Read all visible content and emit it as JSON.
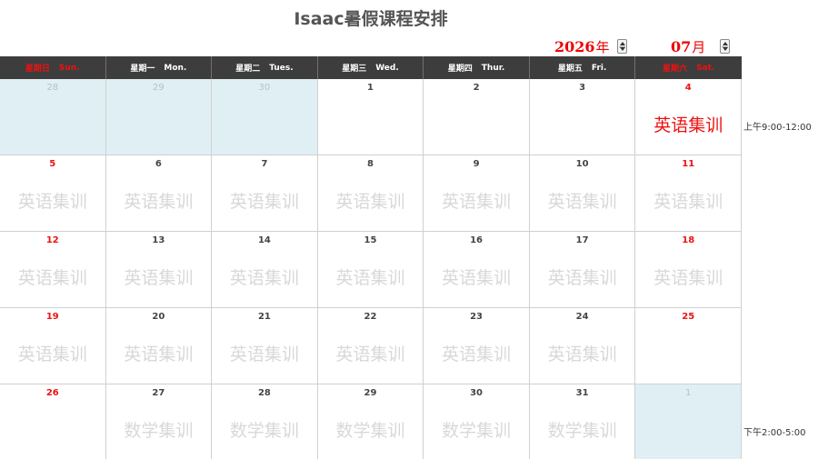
{
  "title": "Isaac暑假课程安排",
  "selector": {
    "year": "2026",
    "year_unit": "年",
    "month": "07",
    "month_unit": "月"
  },
  "weekdays": [
    {
      "cn": "星期日",
      "en": "Sun.",
      "weekend": true
    },
    {
      "cn": "星期一",
      "en": "Mon.",
      "weekend": false
    },
    {
      "cn": "星期二",
      "en": "Tues.",
      "weekend": false
    },
    {
      "cn": "星期三",
      "en": "Wed.",
      "weekend": false
    },
    {
      "cn": "星期四",
      "en": "Thur.",
      "weekend": false
    },
    {
      "cn": "星期五",
      "en": "Fri.",
      "weekend": false
    },
    {
      "cn": "星期六",
      "en": "Sat.",
      "weekend": true
    }
  ],
  "weeks": [
    [
      {
        "day": "28",
        "other": true,
        "event": ""
      },
      {
        "day": "29",
        "other": true,
        "event": ""
      },
      {
        "day": "30",
        "other": true,
        "event": ""
      },
      {
        "day": "1",
        "other": false,
        "event": ""
      },
      {
        "day": "2",
        "other": false,
        "event": ""
      },
      {
        "day": "3",
        "other": false,
        "event": ""
      },
      {
        "day": "4",
        "other": false,
        "event": "英语集训",
        "highlight": true
      }
    ],
    [
      {
        "day": "5",
        "other": false,
        "event": "英语集训"
      },
      {
        "day": "6",
        "other": false,
        "event": "英语集训"
      },
      {
        "day": "7",
        "other": false,
        "event": "英语集训"
      },
      {
        "day": "8",
        "other": false,
        "event": "英语集训"
      },
      {
        "day": "9",
        "other": false,
        "event": "英语集训"
      },
      {
        "day": "10",
        "other": false,
        "event": "英语集训"
      },
      {
        "day": "11",
        "other": false,
        "event": "英语集训"
      }
    ],
    [
      {
        "day": "12",
        "other": false,
        "event": "英语集训"
      },
      {
        "day": "13",
        "other": false,
        "event": "英语集训"
      },
      {
        "day": "14",
        "other": false,
        "event": "英语集训"
      },
      {
        "day": "15",
        "other": false,
        "event": "英语集训"
      },
      {
        "day": "16",
        "other": false,
        "event": "英语集训"
      },
      {
        "day": "17",
        "other": false,
        "event": "英语集训"
      },
      {
        "day": "18",
        "other": false,
        "event": "英语集训"
      }
    ],
    [
      {
        "day": "19",
        "other": false,
        "event": "英语集训"
      },
      {
        "day": "20",
        "other": false,
        "event": "英语集训"
      },
      {
        "day": "21",
        "other": false,
        "event": "英语集训"
      },
      {
        "day": "22",
        "other": false,
        "event": "英语集训"
      },
      {
        "day": "23",
        "other": false,
        "event": "英语集训"
      },
      {
        "day": "24",
        "other": false,
        "event": "英语集训"
      },
      {
        "day": "25",
        "other": false,
        "event": ""
      }
    ],
    [
      {
        "day": "26",
        "other": false,
        "event": ""
      },
      {
        "day": "27",
        "other": false,
        "event": "数学集训"
      },
      {
        "day": "28",
        "other": false,
        "event": "数学集训"
      },
      {
        "day": "29",
        "other": false,
        "event": "数学集训"
      },
      {
        "day": "30",
        "other": false,
        "event": "数学集训"
      },
      {
        "day": "31",
        "other": false,
        "event": "数学集训"
      },
      {
        "day": "1",
        "other": true,
        "event": ""
      }
    ]
  ],
  "side_notes": {
    "morning": "上午9:00-12:00",
    "afternoon": "下午2:00-5:00"
  }
}
